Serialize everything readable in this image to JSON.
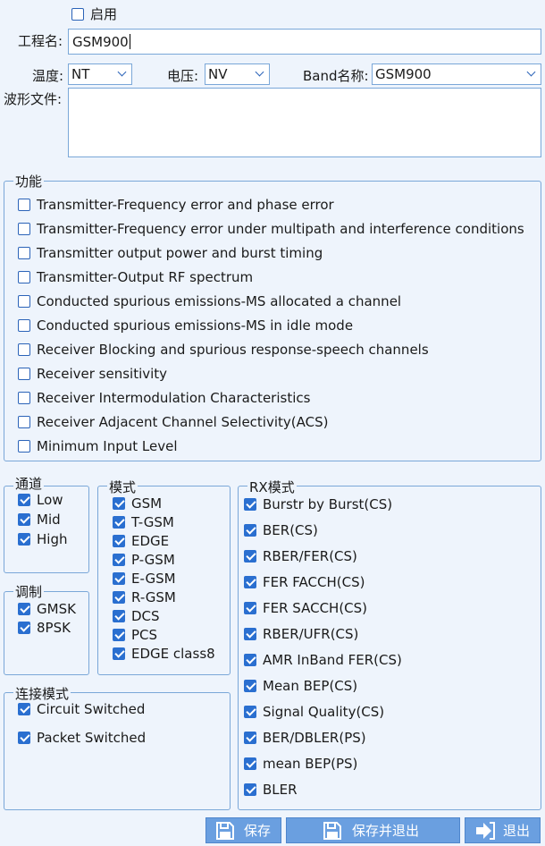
{
  "enable": {
    "label": "启用",
    "checked": false
  },
  "project": {
    "label": "工程名:",
    "value": "GSM900"
  },
  "temp": {
    "label": "温度:",
    "value": "NT"
  },
  "voltage": {
    "label": "电压:",
    "value": "NV"
  },
  "band": {
    "label": "Band名称:",
    "value": "GSM900"
  },
  "waveform": {
    "label": "波形文件:",
    "value": ""
  },
  "functions": {
    "title": "功能",
    "items": [
      "Transmitter-Frequency error and phase error",
      "Transmitter-Frequency error under multipath and interference conditions",
      "Transmitter output power and burst timing",
      "Transmitter-Output RF spectrum",
      "Conducted spurious emissions-MS allocated a channel",
      "Conducted spurious emissions-MS in idle mode",
      "Receiver Blocking and spurious response-speech channels",
      "Receiver sensitivity",
      "Receiver Intermodulation Characteristics",
      "Receiver Adjacent Channel Selectivity(ACS)",
      "Minimum Input Level"
    ]
  },
  "channel": {
    "title": "通道",
    "items": [
      "Low",
      "Mid",
      "High"
    ]
  },
  "modulation": {
    "title": "调制",
    "items": [
      "GMSK",
      "8PSK"
    ]
  },
  "mode": {
    "title": "模式",
    "items": [
      "GSM",
      "T-GSM",
      "EDGE",
      "P-GSM",
      "E-GSM",
      "R-GSM",
      "DCS",
      "PCS",
      "EDGE class8"
    ]
  },
  "rxmode": {
    "title": "RX模式",
    "items": [
      "Burstr by Burst(CS)",
      "BER(CS)",
      "RBER/FER(CS)",
      "FER FACCH(CS)",
      "FER SACCH(CS)",
      "RBER/UFR(CS)",
      "AMR InBand FER(CS)",
      "Mean BEP(CS)",
      "Signal Quality(CS)",
      "BER/DBLER(PS)",
      "mean BEP(PS)",
      "BLER"
    ]
  },
  "connection": {
    "title": "连接模式",
    "items": [
      "Circuit Switched",
      "Packet Switched"
    ]
  },
  "buttons": {
    "save": "保存",
    "save_exit": "保存并退出",
    "exit": "退出"
  },
  "icons": {
    "save": "floppy-disk-icon",
    "exit": "exit-arrow-icon"
  },
  "colors": {
    "accent": "#2a6fd0",
    "button": "#6a9fe0",
    "background": "#eef4fc",
    "border": "#7aa7d8"
  }
}
